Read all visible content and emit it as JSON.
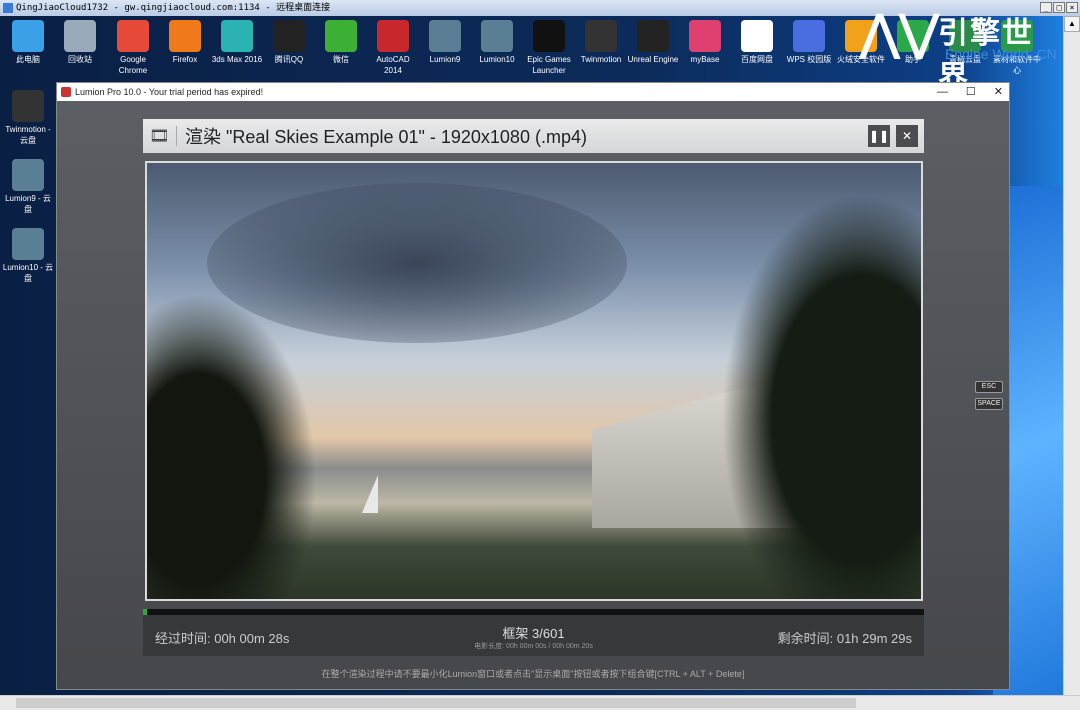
{
  "rdp": {
    "title": "QingJiaoCloud1732 - gw.qingjiaocloud.com:1134 - 远程桌面连接",
    "min": "_",
    "max": "□",
    "close": "×"
  },
  "desktop_icons": [
    {
      "label": "此电脑",
      "color": "#3aa0e8"
    },
    {
      "label": "回收站",
      "color": "#9ab"
    },
    {
      "label": "Google Chrome",
      "color": "#e84a3a"
    },
    {
      "label": "Firefox",
      "color": "#f07a1a"
    },
    {
      "label": "3ds Max 2016",
      "color": "#2bb3b3"
    },
    {
      "label": "腾讯QQ",
      "color": "#222"
    },
    {
      "label": "微信",
      "color": "#3cb034"
    },
    {
      "label": "AutoCAD 2014",
      "color": "#c8282c"
    },
    {
      "label": "Lumion9",
      "color": "#5a7f94"
    },
    {
      "label": "Lumion10",
      "color": "#5a7f94"
    },
    {
      "label": "Epic Games Launcher",
      "color": "#111"
    },
    {
      "label": "Twinmotion",
      "color": "#333"
    },
    {
      "label": "Unreal Engine",
      "color": "#222"
    },
    {
      "label": "myBase",
      "color": "#e04070"
    },
    {
      "label": "百度网盘",
      "color": "#fff"
    },
    {
      "label": "WPS 校园版",
      "color": "#4a6ee0"
    },
    {
      "label": "火绒安全软件",
      "color": "#f2a21a"
    },
    {
      "label": "助手",
      "color": "#2aa84a"
    },
    {
      "label": "青椒云盘",
      "color": "#2a8a4a"
    },
    {
      "label": "素材和软件中心",
      "color": "#2a9a4a"
    }
  ],
  "left_icons": [
    {
      "label": "Twinmotion - 云盘",
      "color": "#333"
    },
    {
      "label": "Lumion9 - 云盘",
      "color": "#5a7f94"
    },
    {
      "label": "Lumion10 - 云盘",
      "color": "#5a7f94"
    }
  ],
  "watermark": {
    "cn": "引擎世界",
    "en": "Engine World .CN"
  },
  "lumion": {
    "title": "Lumion Pro 10.0 - Your trial period has expired!",
    "win_min": "—",
    "win_max": "☐",
    "win_close": "✕",
    "render_title": "渲染 \"Real Skies Example 01\" - 1920x1080 (.mp4)",
    "pause": "❚❚",
    "close": "✕",
    "progress_percent": 0.5,
    "elapsed_label": "经过时间:  00h 00m 28s",
    "frame_label": "框架 3/601",
    "movie_length": "电影长度: 00h 00m 00s / 00h 00m 20s",
    "remaining_label": "剩余时间:  01h 29m 29s",
    "note": "在整个渲染过程中请不要最小化Lumion窗口或者点击\"显示桌面\"按钮或者按下组合键[CTRL + ALT + Delete]",
    "esc": "ESC",
    "space": "SPACE"
  }
}
